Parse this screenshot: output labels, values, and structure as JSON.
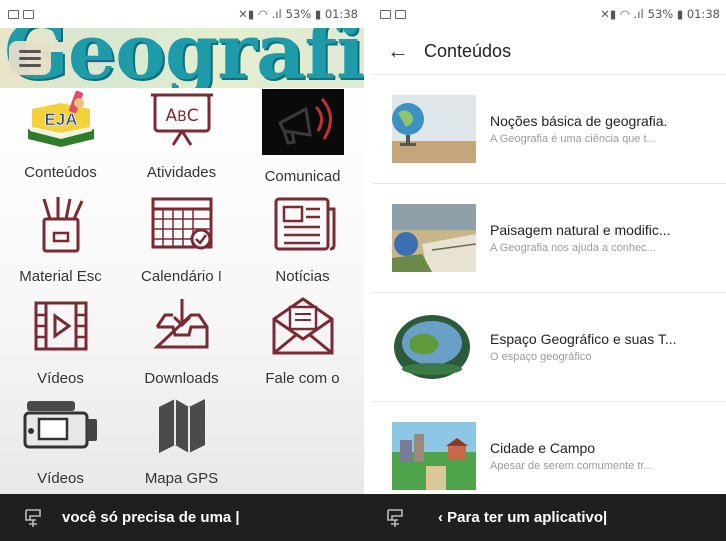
{
  "left": {
    "status": {
      "right": "53% ▮ 01:38"
    },
    "banner_title": "Geografia",
    "tiles": [
      {
        "label": "Conteúdos",
        "icon": "eja-book-icon"
      },
      {
        "label": "Atividades",
        "icon": "abc-board-icon"
      },
      {
        "label": "Comunicad",
        "icon": "megaphone-icon"
      },
      {
        "label": "Material Esc",
        "icon": "pencil-holder-icon"
      },
      {
        "label": "Calendário I",
        "icon": "calendar-icon"
      },
      {
        "label": "Notícias",
        "icon": "newspaper-icon"
      },
      {
        "label": "Vídeos",
        "icon": "film-icon"
      },
      {
        "label": "Downloads",
        "icon": "download-tray-icon"
      },
      {
        "label": "Fale com o",
        "icon": "mail-icon"
      },
      {
        "label": "Vídeos",
        "icon": "camcorder-icon"
      },
      {
        "label": "Mapa GPS",
        "icon": "map-icon"
      }
    ],
    "bottom_text": "você só precisa de uma |"
  },
  "right": {
    "status": {
      "right": "53% ▮ 01:38"
    },
    "title": "Conteúdos",
    "items": [
      {
        "title": "Noções básica de geografia.",
        "subtitle": "A Geografia é uma ciência que t..."
      },
      {
        "title": "Paisagem natural e modific...",
        "subtitle": "A Geografia nos ajuda a conhec..."
      },
      {
        "title": "Espaço Geográfico e suas T...",
        "subtitle": "O espaço geográfico"
      },
      {
        "title": "Cidade e Campo",
        "subtitle": "Apesar de serem comumente tr..."
      }
    ],
    "bottom_text": "‹ Para ter um aplicativo|"
  },
  "colors": {
    "accent_dark_red": "#7a2a33",
    "banner_teal": "#1e9aa8",
    "bottom_bar": "#1f1f1f"
  }
}
